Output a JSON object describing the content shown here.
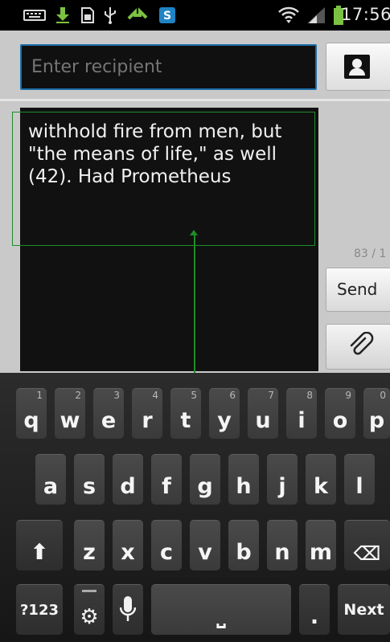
{
  "status_bar": {
    "time": "17:56",
    "icons": [
      "keyboard-icon",
      "download-icon",
      "sim-icon",
      "usb-icon",
      "sync-icon",
      "s-app-icon",
      "wifi-icon",
      "signal-icon",
      "battery-icon"
    ]
  },
  "compose": {
    "recipient_placeholder": "Enter recipient",
    "message_text": "withhold fire from men, but\n\"the means of life,\" as well\n(42). Had Prometheus",
    "char_count": "83 / 1",
    "send_label": "Send",
    "attach_glyph": "🖇"
  },
  "keyboard": {
    "row1": [
      {
        "label": "q",
        "num": "1"
      },
      {
        "label": "w",
        "num": "2"
      },
      {
        "label": "e",
        "num": "3"
      },
      {
        "label": "r",
        "num": "4"
      },
      {
        "label": "t",
        "num": "5"
      },
      {
        "label": "y",
        "num": "6"
      },
      {
        "label": "u",
        "num": "7"
      },
      {
        "label": "i",
        "num": "8"
      },
      {
        "label": "o",
        "num": "9"
      },
      {
        "label": "p",
        "num": "0"
      }
    ],
    "row2": [
      "a",
      "s",
      "d",
      "f",
      "g",
      "h",
      "j",
      "k",
      "l"
    ],
    "row3": [
      "z",
      "x",
      "c",
      "v",
      "b",
      "n",
      "m"
    ],
    "shift_glyph": "⬆",
    "backspace_glyph": "⌫",
    "symbols_label": "?123",
    "settings_glyph": "⚙",
    "mic_glyph": "🎙",
    "space_glyph": "⎵",
    "period_label": ".",
    "next_label": "Next"
  }
}
